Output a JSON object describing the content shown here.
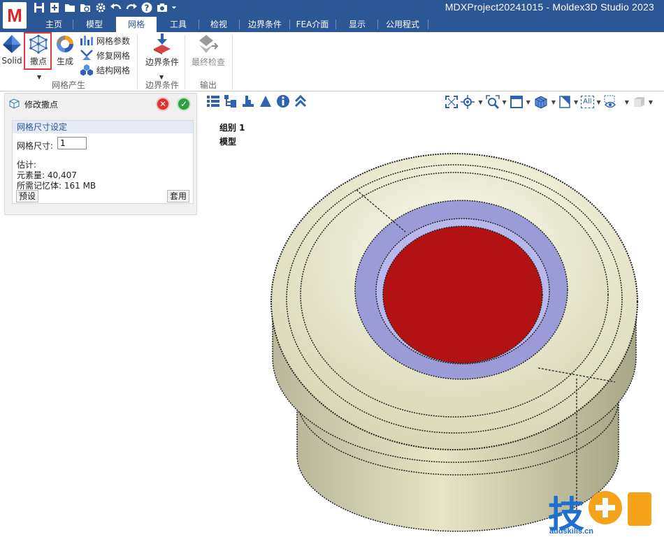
{
  "app": {
    "logo_letter": "M",
    "window_title": "MDXProject20241015 - Moldex3D Studio 2023"
  },
  "quick_access": [
    "save-icon",
    "new-icon",
    "open-folder-icon",
    "search-folder-icon",
    "gear-icon",
    "undo-icon",
    "redo-icon",
    "help-icon",
    "camera-icon",
    "chevron-down-icon"
  ],
  "tabs": [
    {
      "label": "主页",
      "active": false
    },
    {
      "label": "模型",
      "active": false
    },
    {
      "label": "网格",
      "active": true
    },
    {
      "label": "工具",
      "active": false
    },
    {
      "label": "检视",
      "active": false
    },
    {
      "label": "边界条件",
      "active": false
    },
    {
      "label": "FEA介面",
      "active": false
    },
    {
      "label": "显示",
      "active": false
    },
    {
      "label": "公用程式",
      "active": false
    }
  ],
  "ribbon": {
    "solid_label": "Solid",
    "seed_label": "撒点",
    "generate_label": "生成",
    "mesh_params_label": "网格参数",
    "repair_mesh_label": "修复网格",
    "structured_mesh_label": "结构网格",
    "group_mesh_label": "网格产生",
    "boundary_btn_label": "边界条件",
    "group_boundary_label": "边界条件",
    "final_check_label": "最终检查",
    "group_output_label": "输出"
  },
  "panel": {
    "title": "修改撒点",
    "group_title": "网格尺寸设定",
    "mesh_size_label": "网格尺寸:",
    "mesh_size_value": "1",
    "estimate_label": "估计:",
    "element_count": "元素量: 40,407",
    "memory": "所需记忆体: 161 MB",
    "preset_button": "预设",
    "apply_button": "套用"
  },
  "viewport": {
    "group_label": "组别 1",
    "model_label": "模型",
    "filter_label": "All"
  },
  "watermark": {
    "text": "技",
    "url": "addskills.cn"
  },
  "colors": {
    "brand_blue": "#2b5797",
    "model_body": "#e8e8cc",
    "model_ring": "#9b9bd8",
    "model_core": "#b31212",
    "highlight": "#e23a3a"
  }
}
